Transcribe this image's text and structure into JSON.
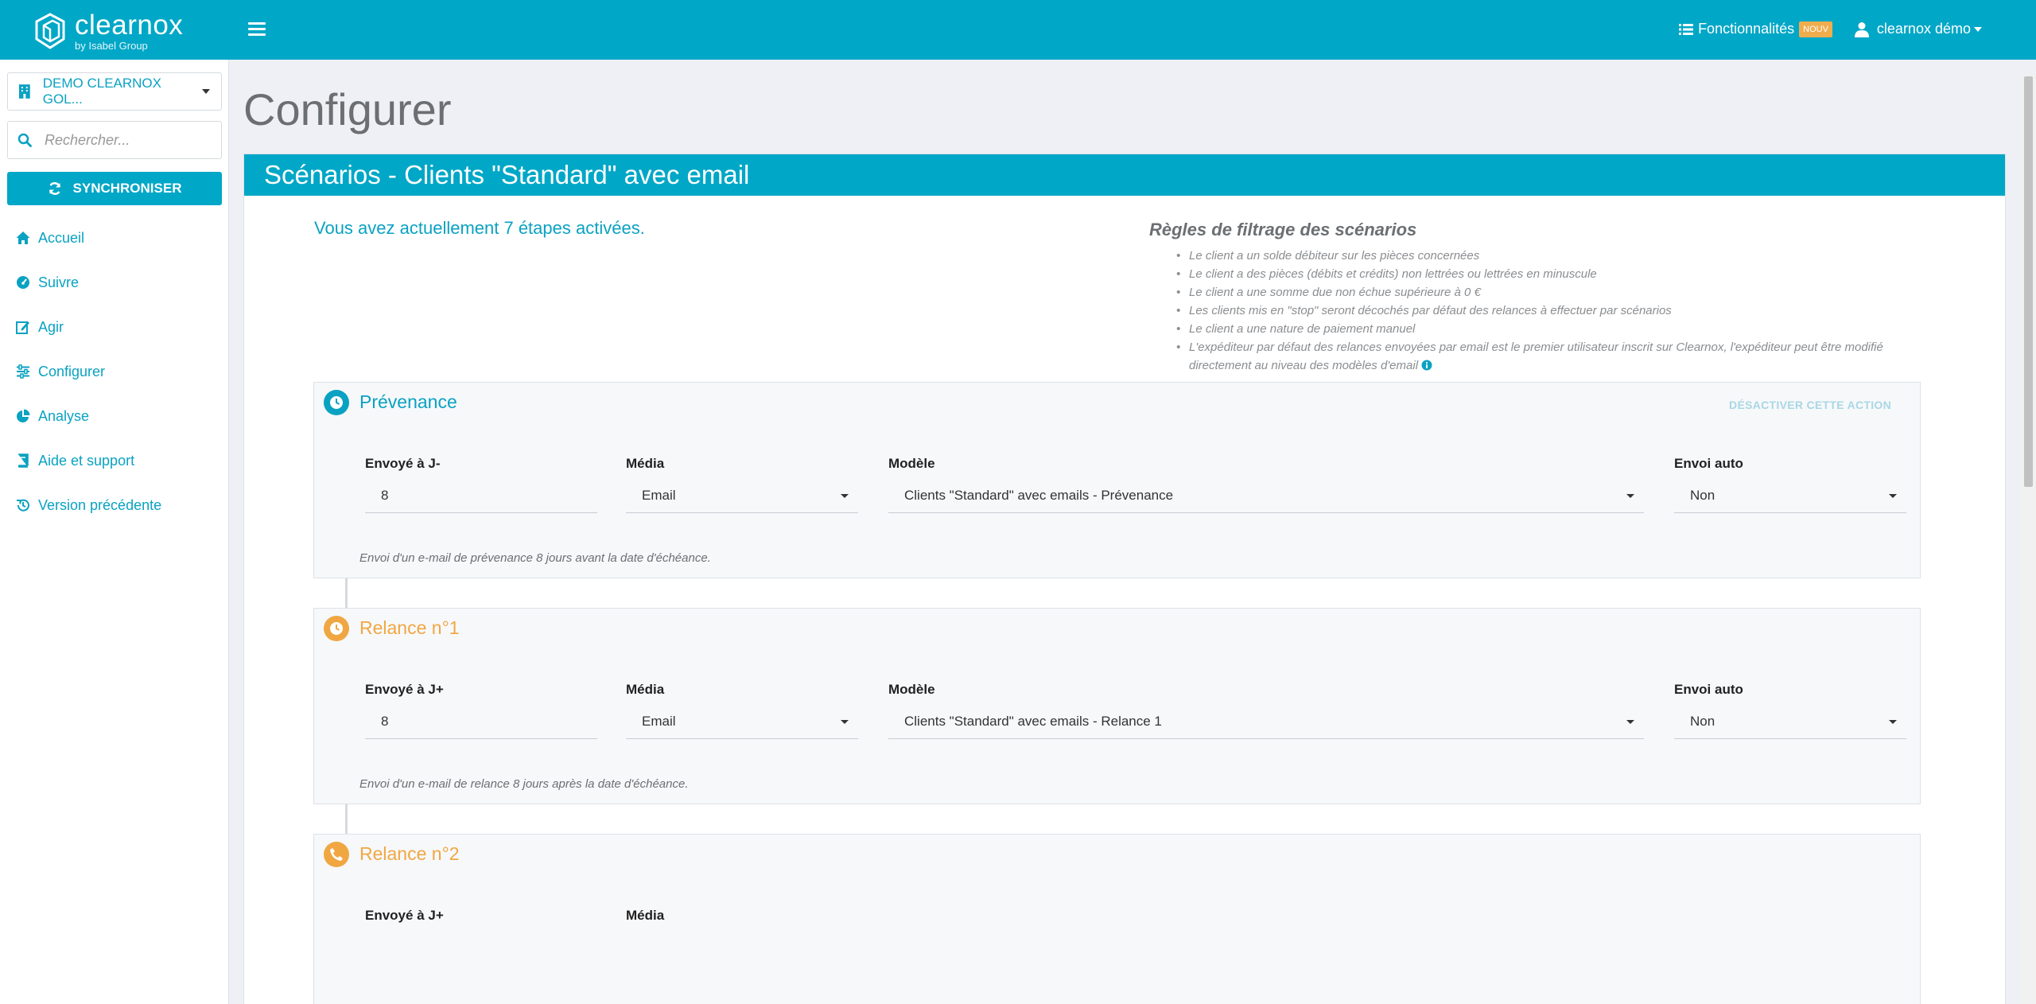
{
  "header": {
    "logo_name": "clearnox",
    "logo_sub": "by Isabel Group",
    "features_label": "Fonctionnalités",
    "features_badge": "NOUV",
    "user_label": "clearnox démo"
  },
  "sidebar": {
    "company": "DEMO CLEARNOX GOL...",
    "search_placeholder": "Rechercher...",
    "sync_label": "SYNCHRONISER",
    "items": [
      {
        "label": "Accueil",
        "icon": "home-icon"
      },
      {
        "label": "Suivre",
        "icon": "dashboard-icon"
      },
      {
        "label": "Agir",
        "icon": "edit-icon"
      },
      {
        "label": "Configurer",
        "icon": "sliders-icon"
      },
      {
        "label": "Analyse",
        "icon": "pie-chart-icon"
      },
      {
        "label": "Aide et support",
        "icon": "book-icon"
      },
      {
        "label": "Version précédente",
        "icon": "history-icon"
      }
    ]
  },
  "page": {
    "title": "Configurer",
    "card_title": "Scénarios - Clients \"Standard\" avec email",
    "active_steps": "Vous avez actuellement 7 étapes activées.",
    "rules_title": "Règles de filtrage des scénarios",
    "rules": [
      "Le client a un solde débiteur sur les pièces concernées",
      "Le client a des pièces (débits et crédits) non lettrées ou lettrées en minuscule",
      "Le client a une somme due non échue supérieure à 0 €",
      "Les clients mis en \"stop\" seront décochés par défaut des relances à effectuer par scénarios",
      "Le client a une nature de paiement manuel",
      "L'expéditeur par défaut des relances envoyées par email est le premier utilisateur inscrit sur Clearnox, l'expéditeur peut être modifié directement au niveau des modèles d'email"
    ]
  },
  "steps": [
    {
      "title": "Prévenance",
      "color": "#0aa2c2",
      "icon": "clock-icon",
      "deactivate": "DÉSACTIVER CETTE ACTION",
      "labels": {
        "days": "Envoyé à J-",
        "media": "Média",
        "model": "Modèle",
        "auto": "Envoi auto"
      },
      "values": {
        "days": "8",
        "media": "Email",
        "model": "Clients \"Standard\" avec emails - Prévenance",
        "auto": "Non"
      },
      "desc": "Envoi d'un e-mail de prévenance 8 jours avant la date d'échéance."
    },
    {
      "title": "Relance n°1",
      "color": "#f0a742",
      "icon": "clock-icon",
      "deactivate": "",
      "labels": {
        "days": "Envoyé à J+",
        "media": "Média",
        "model": "Modèle",
        "auto": "Envoi auto"
      },
      "values": {
        "days": "8",
        "media": "Email",
        "model": "Clients \"Standard\" avec emails - Relance 1",
        "auto": "Non"
      },
      "desc": "Envoi d'un e-mail de relance 8 jours après la date d'échéance."
    },
    {
      "title": "Relance n°2",
      "color": "#f0a742",
      "icon": "phone-icon",
      "deactivate": "",
      "labels": {
        "days": "Envoyé à J+",
        "media": "Média"
      },
      "values": {},
      "desc": ""
    }
  ],
  "colors": {
    "brand": "#00a7c7",
    "accent_orange": "#f0a742",
    "badge": "#f0ad4e"
  }
}
